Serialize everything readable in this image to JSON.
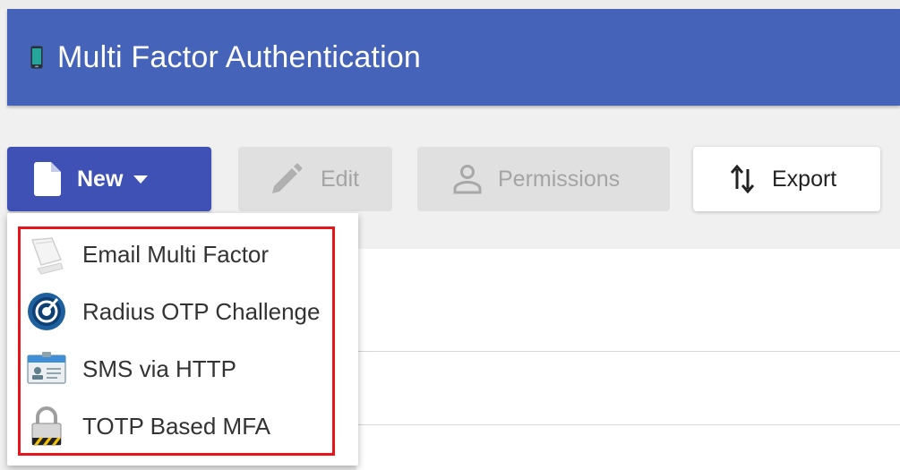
{
  "header": {
    "title": "Multi Factor Authentication",
    "icon": "mobile-phone-icon"
  },
  "toolbar": {
    "new_label": "New",
    "edit_label": "Edit",
    "permissions_label": "Permissions",
    "export_label": "Export"
  },
  "new_menu": {
    "items": [
      {
        "label": "Email Multi Factor",
        "icon": "envelope-paper-icon"
      },
      {
        "label": "Radius OTP Challenge",
        "icon": "radius-target-icon"
      },
      {
        "label": "SMS via HTTP",
        "icon": "id-card-icon"
      },
      {
        "label": "TOTP Based MFA",
        "icon": "padlock-icon"
      }
    ]
  },
  "colors": {
    "header_bg": "#4563b8",
    "primary_button": "#3f51b5",
    "disabled_button": "#e0e0e0",
    "highlight_border": "#e8141c"
  }
}
